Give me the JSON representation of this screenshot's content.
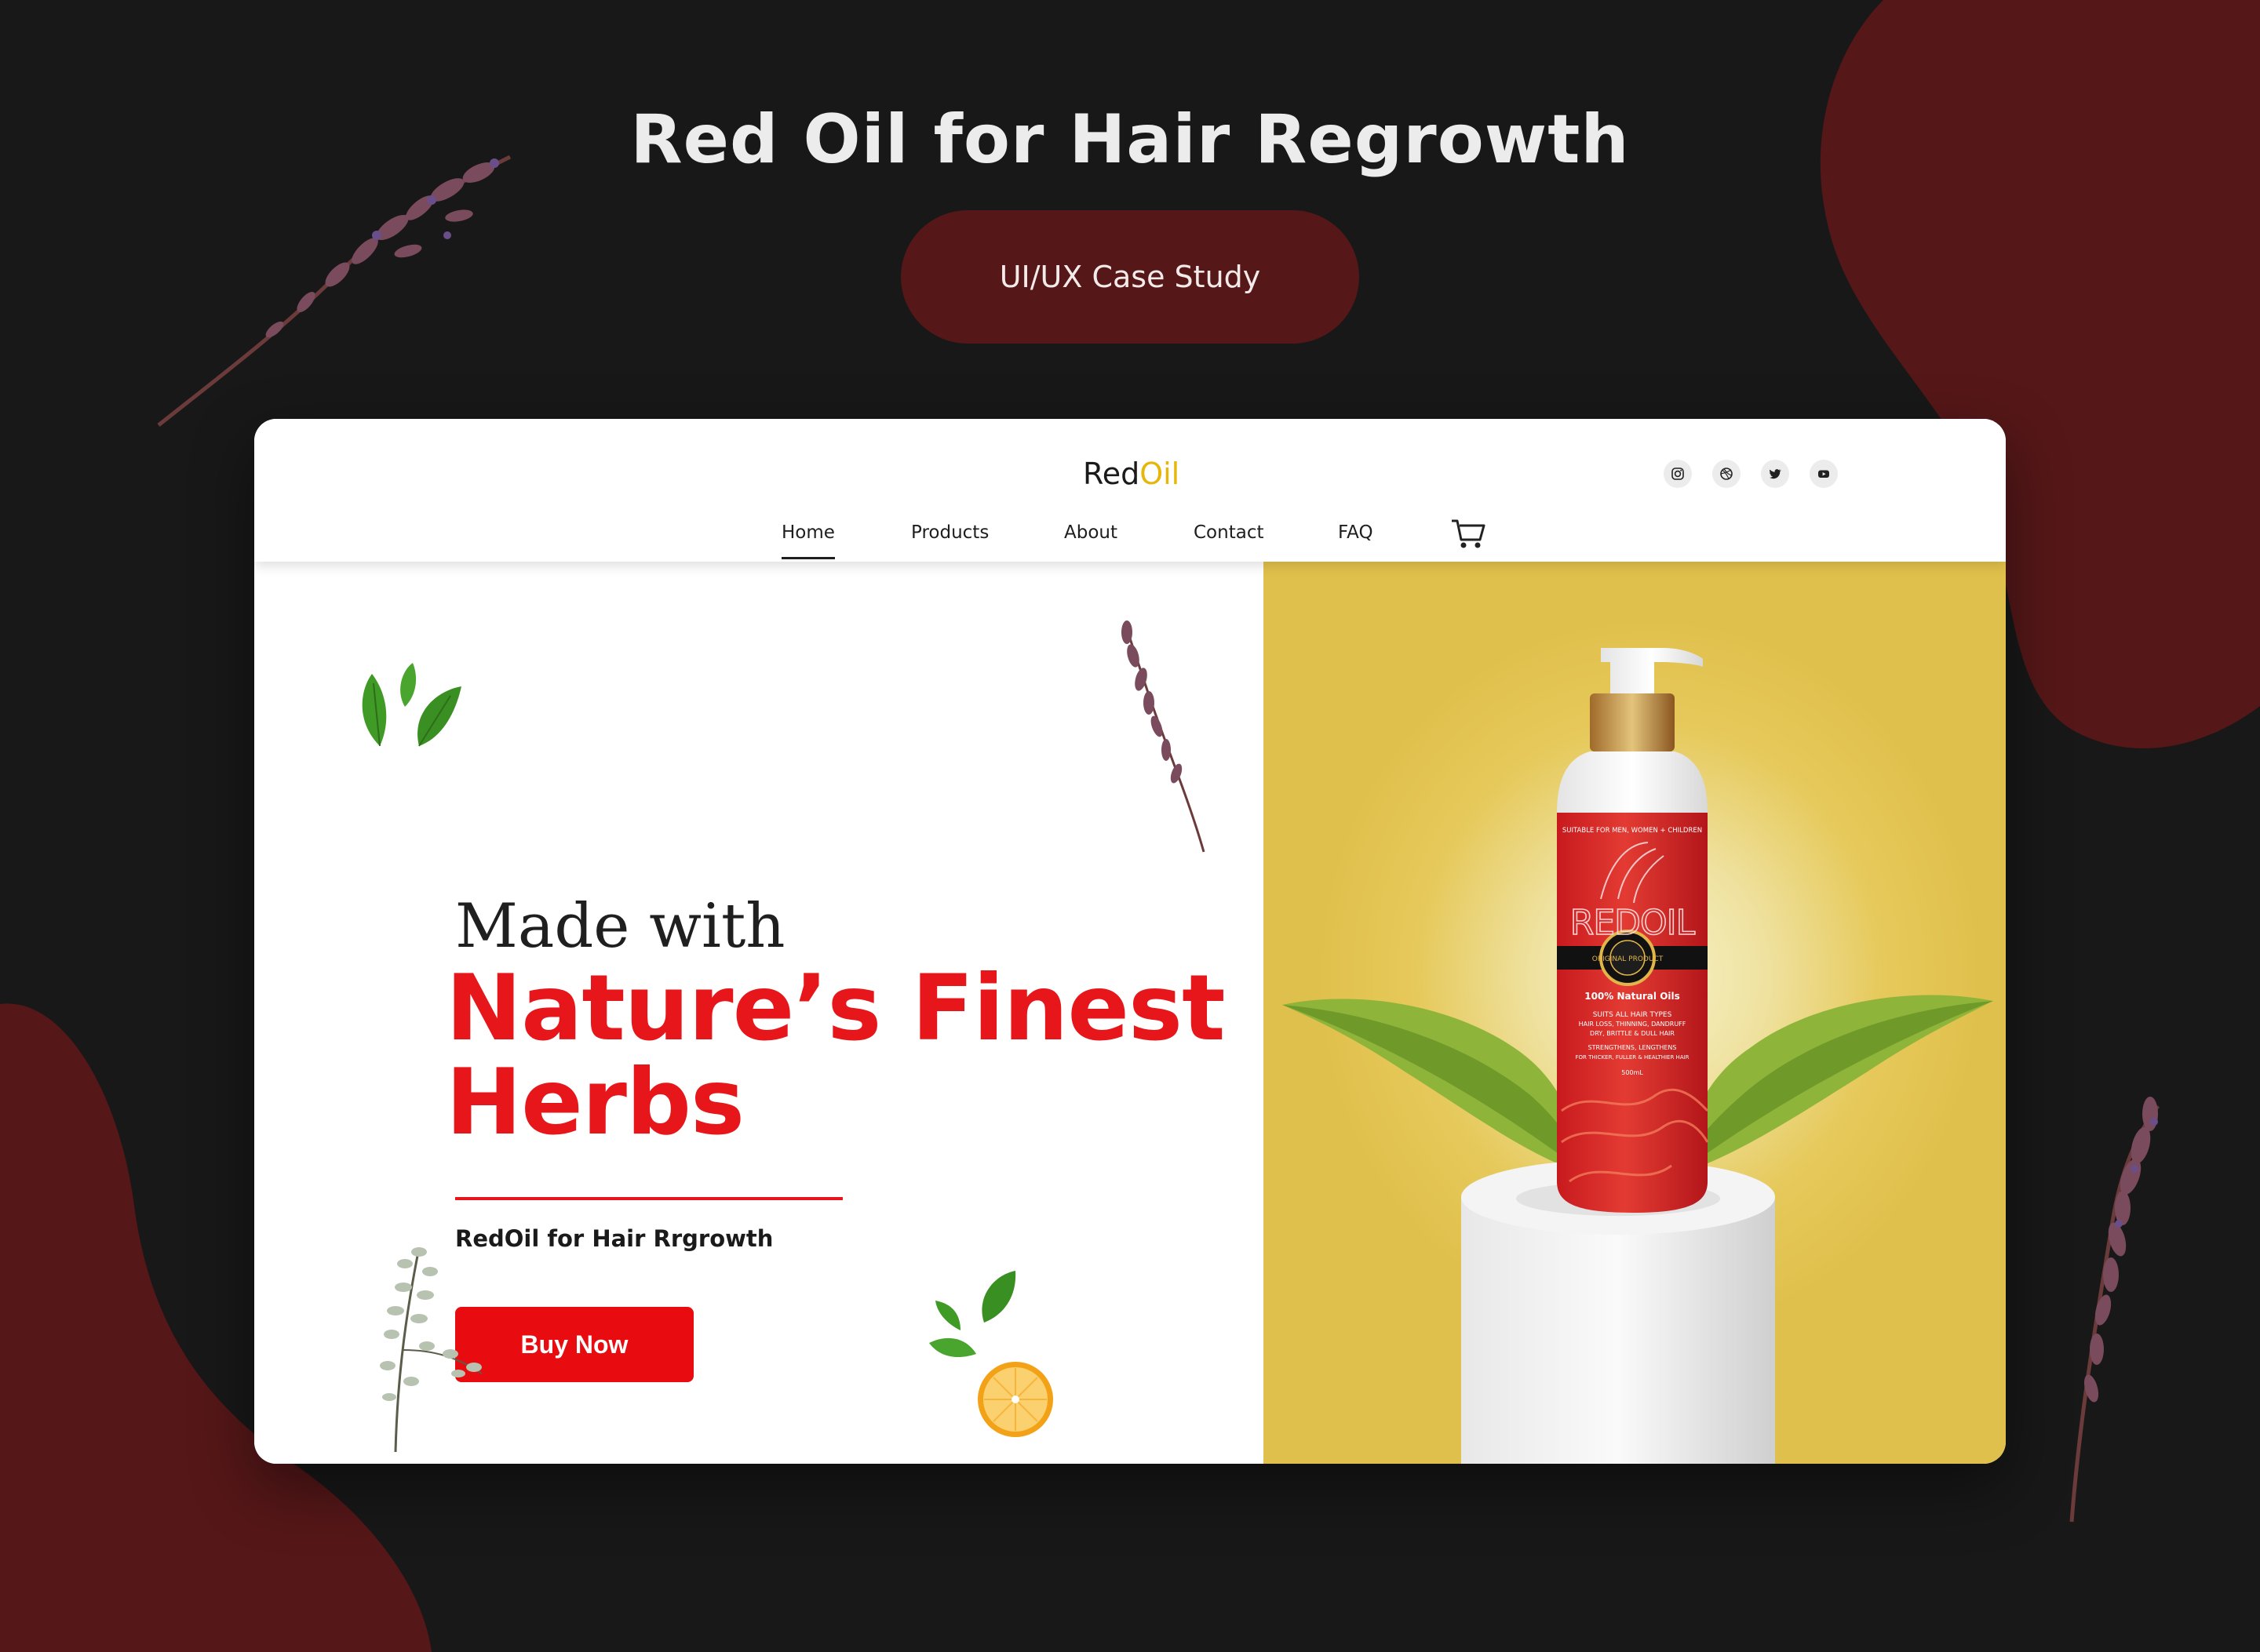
{
  "heading": "Red Oil for Hair Regrowth",
  "case_pill": "UI/UX Case Study",
  "colors": {
    "background": "#181818",
    "blob": "#561718",
    "accent_red": "#e7161a",
    "button_red": "#e80c10",
    "brand_gold": "#e7b60a",
    "hero_yellow": "#e6c95b"
  },
  "site": {
    "brand_part1": "Red",
    "brand_part2": "Oil",
    "social_icons": [
      "instagram-icon",
      "dribbble-icon",
      "twitter-icon",
      "youtube-icon"
    ],
    "nav": [
      "Home",
      "Products",
      "About",
      "Contact",
      "FAQ"
    ],
    "active_nav": "Home",
    "cart_icon": "cart-icon"
  },
  "hero": {
    "line1": "Made with",
    "line2": "Nature’s Finest",
    "line3": "Herbs",
    "subtitle": "RedOil for Hair Rrgrowth",
    "button": "Buy Now"
  },
  "bottle": {
    "top_text": "SUITABLE FOR MEN, WOMEN + CHILDREN",
    "brand": "REDOIL",
    "seal": "ORIGINAL PRODUCT",
    "natural": "100% Natural Oils",
    "desc1": "SUITS ALL HAIR TYPES",
    "desc2": "HAIR LOSS, THINNING, DANDRUFF",
    "desc3": "DRY, BRITTLE & DULL HAIR",
    "desc4": "STRENGTHENS, LENGTHENS",
    "desc5": "FOR THICKER, FULLER & HEALTHIER HAIR",
    "volume": "500mL"
  }
}
